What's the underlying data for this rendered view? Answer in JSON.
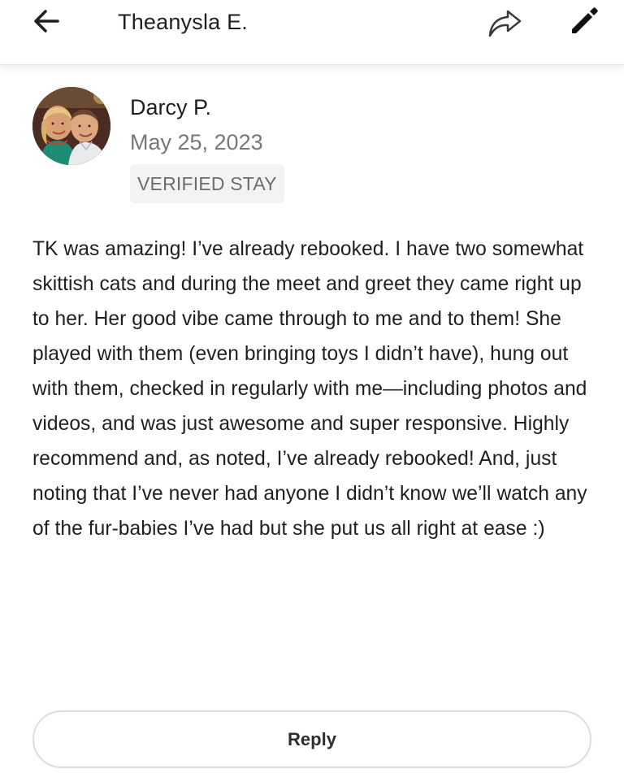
{
  "header": {
    "title": "Theanysla E.",
    "icons": {
      "back": "back-arrow-icon",
      "share": "share-icon",
      "edit": "edit-pencil-icon"
    }
  },
  "review": {
    "reviewer_name": "Darcy P.",
    "date": "May 25, 2023",
    "badge": "VERIFIED STAY",
    "body": "TK was amazing! I’ve already rebooked. I have two somewhat skittish cats and during the meet and greet they came right up to her. Her good vibe came through to me and to them! She played with them (even bringing toys I didn’t have), hung out with them, checked in regularly with me—including photos and videos, and was just awesome and super responsive. Highly recommend and, as noted, I’ve already rebooked! And, just noting that I’ve never had anyone I didn’t know we’ll watch any of the fur-babies I’ve had but she put us all right at ease :)",
    "reply_label": "Reply"
  },
  "colors": {
    "text_primary": "#1f1f1f",
    "text_secondary": "#777777",
    "badge_bg": "#f2f3f4",
    "badge_text": "#6d6d6d",
    "reply_border": "#dadde2",
    "background": "#ffffff"
  }
}
